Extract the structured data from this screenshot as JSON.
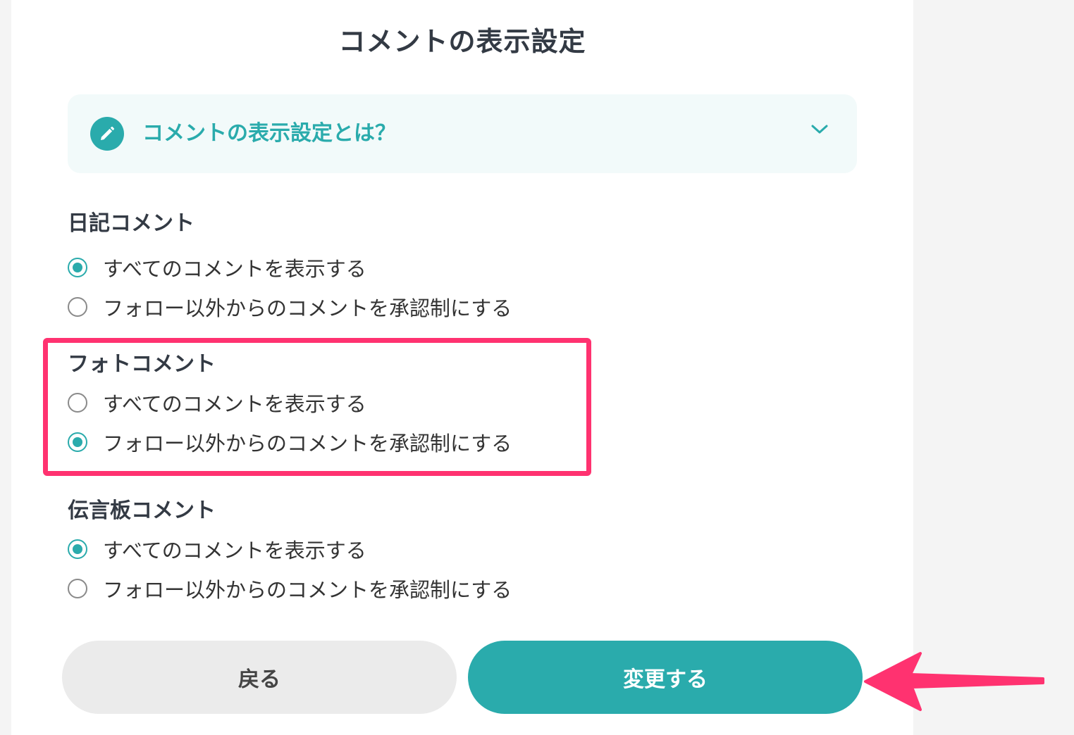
{
  "page": {
    "title": "コメントの表示設定"
  },
  "help": {
    "title": "コメントの表示設定とは？",
    "icon": "pencil-icon",
    "expand_icon": "chevron-down-icon"
  },
  "sections": [
    {
      "title": "日記コメント",
      "options": [
        {
          "label": "すべてのコメントを表示する",
          "checked": true
        },
        {
          "label": "フォロー以外からのコメントを承認制にする",
          "checked": false
        }
      ]
    },
    {
      "title": "フォトコメント",
      "options": [
        {
          "label": "すべてのコメントを表示する",
          "checked": false
        },
        {
          "label": "フォロー以外からのコメントを承認制にする",
          "checked": true
        }
      ]
    },
    {
      "title": "伝言板コメント",
      "options": [
        {
          "label": "すべてのコメントを表示する",
          "checked": true
        },
        {
          "label": "フォロー以外からのコメントを承認制にする",
          "checked": false
        }
      ]
    }
  ],
  "buttons": {
    "back_label": "戻る",
    "save_label": "変更する"
  },
  "colors": {
    "accent": "#2aabac",
    "highlight": "#ff3270",
    "help_bg": "#f2fafa",
    "back_button_bg": "#ebebeb"
  }
}
